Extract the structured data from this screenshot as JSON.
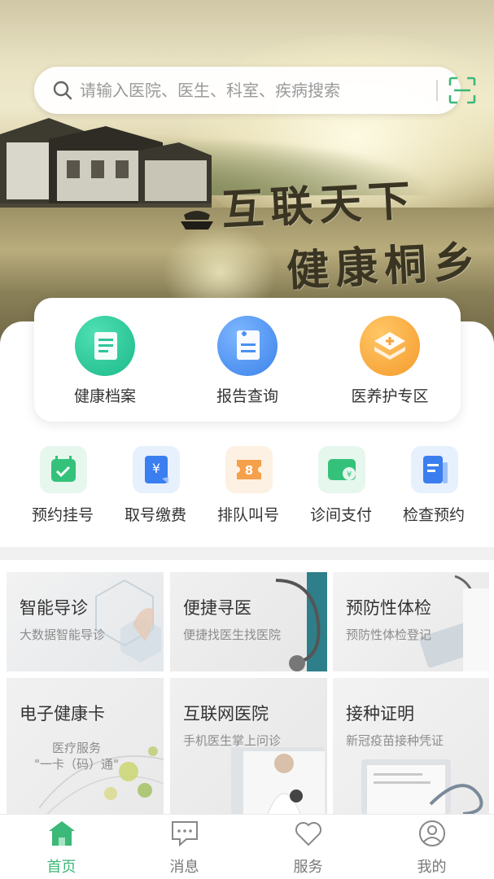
{
  "search": {
    "placeholder": "请输入医院、医生、科室、疾病搜索"
  },
  "banner": {
    "line1": "互联天下",
    "line2": "健康桐乡"
  },
  "main_features": [
    {
      "label": "健康档案",
      "icon": "document-icon",
      "color": "#2fc59a"
    },
    {
      "label": "报告查询",
      "icon": "report-icon",
      "color": "#4a90f0"
    },
    {
      "label": "医养护专区",
      "icon": "medical-layers-icon",
      "color": "#f6a43a"
    }
  ],
  "quick_actions": [
    {
      "label": "预约挂号",
      "icon": "calendar-check-icon",
      "color": "#34c27a"
    },
    {
      "label": "取号缴费",
      "icon": "yuan-ticket-icon",
      "color": "#3a7ef0"
    },
    {
      "label": "排队叫号",
      "icon": "queue-number-icon",
      "color": "#f5a04a"
    },
    {
      "label": "诊间支付",
      "icon": "wallet-icon",
      "color": "#34c27a"
    },
    {
      "label": "检查预约",
      "icon": "exam-doc-icon",
      "color": "#3a7ef0"
    }
  ],
  "services": [
    {
      "title": "智能导诊",
      "subtitle": "大数据智能导诊"
    },
    {
      "title": "便捷寻医",
      "subtitle": "便捷找医生找医院"
    },
    {
      "title": "预防性体检",
      "subtitle": "预防性体检登记"
    },
    {
      "title": "电子健康卡",
      "subtitle_line1": "医疗服务",
      "subtitle_line2": "\"一卡（码）通\""
    },
    {
      "title": "互联网医院",
      "subtitle": "手机医生掌上问诊"
    },
    {
      "title": "接种证明",
      "subtitle": "新冠疫苗接种凭证"
    }
  ],
  "tabbar": [
    {
      "label": "首页",
      "icon": "home-icon",
      "active": true
    },
    {
      "label": "消息",
      "icon": "message-icon",
      "active": false
    },
    {
      "label": "服务",
      "icon": "heart-icon",
      "active": false
    },
    {
      "label": "我的",
      "icon": "user-icon",
      "active": false
    }
  ],
  "colors": {
    "accent": "#3cb878",
    "text": "#333333",
    "muted": "#8c8c8c"
  }
}
